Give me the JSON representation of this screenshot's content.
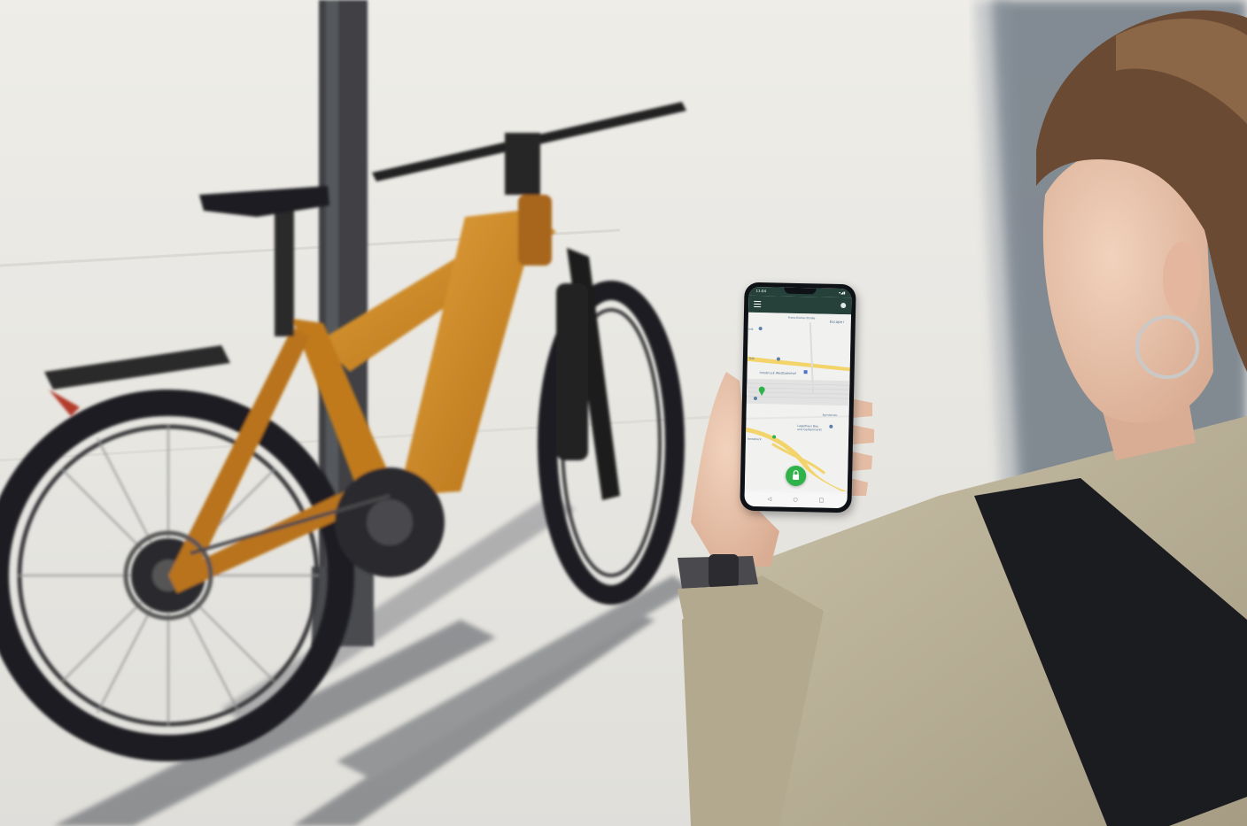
{
  "phone": {
    "status_time": "11:04",
    "status_icons": "▾◢▮",
    "nav_back": "◁",
    "nav_home": "○",
    "nav_recent": "□"
  },
  "map_labels": {
    "top_street": "Franz-Fischer-Straße",
    "escape": "Escape i",
    "station": "Innsbruck Westbahnhof",
    "lagerhaus_1": "Lagerhaus Bau",
    "lagerhaus_2": "und Gartenmarkt",
    "innsbruck": "Innsbruck",
    "left_poi": "rvik",
    "dell": "Dell",
    "side_street": "Egerdachstr."
  },
  "colors": {
    "app_bar": "#25413a",
    "lock_green": "#2fb24a",
    "bike_orange": "#c8841f",
    "road_yellow": "#f3d46b"
  },
  "icons": {
    "menu": "menu-icon",
    "lock": "lock-icon",
    "pin": "map-pin-icon",
    "station": "train-station-icon"
  }
}
